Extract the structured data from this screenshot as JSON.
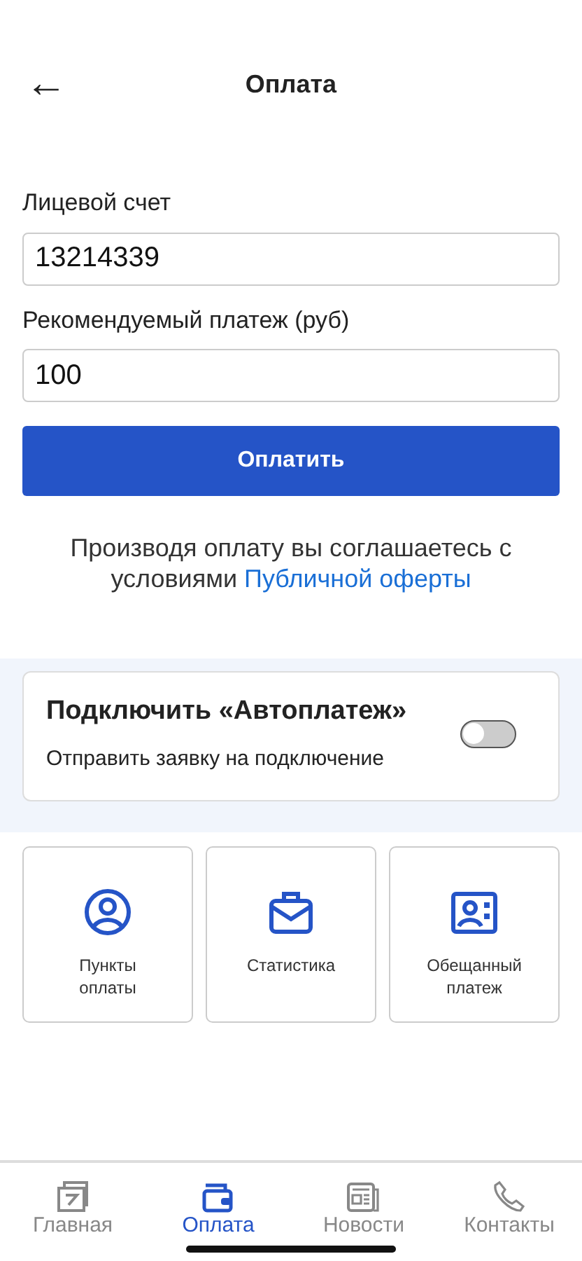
{
  "header": {
    "back": "←",
    "title": "Оплата"
  },
  "fields": [
    {
      "label": "Лицевой счет",
      "value": "13214339"
    },
    {
      "label": "Рекомендуемый платеж (руб)",
      "value": "100"
    }
  ],
  "pay_button": "Оплатить",
  "consent": {
    "text": "Производя оплату вы соглашаетесь с условиями",
    "link": "Публичной оферты"
  },
  "autopay": {
    "title": "Подключить «Автоплатеж»",
    "subtitle": "Отправить заявку на подключение",
    "on": false
  },
  "tiles": [
    {
      "label": "Пункты оплаты"
    },
    {
      "label": "Статистика"
    },
    {
      "label": "Обещанный платеж"
    }
  ],
  "tabs": [
    {
      "label": "Главная",
      "selected": false
    },
    {
      "label": "Оплата",
      "selected": true
    },
    {
      "label": "Новости",
      "selected": false
    },
    {
      "label": "Контакты",
      "selected": false
    }
  ]
}
